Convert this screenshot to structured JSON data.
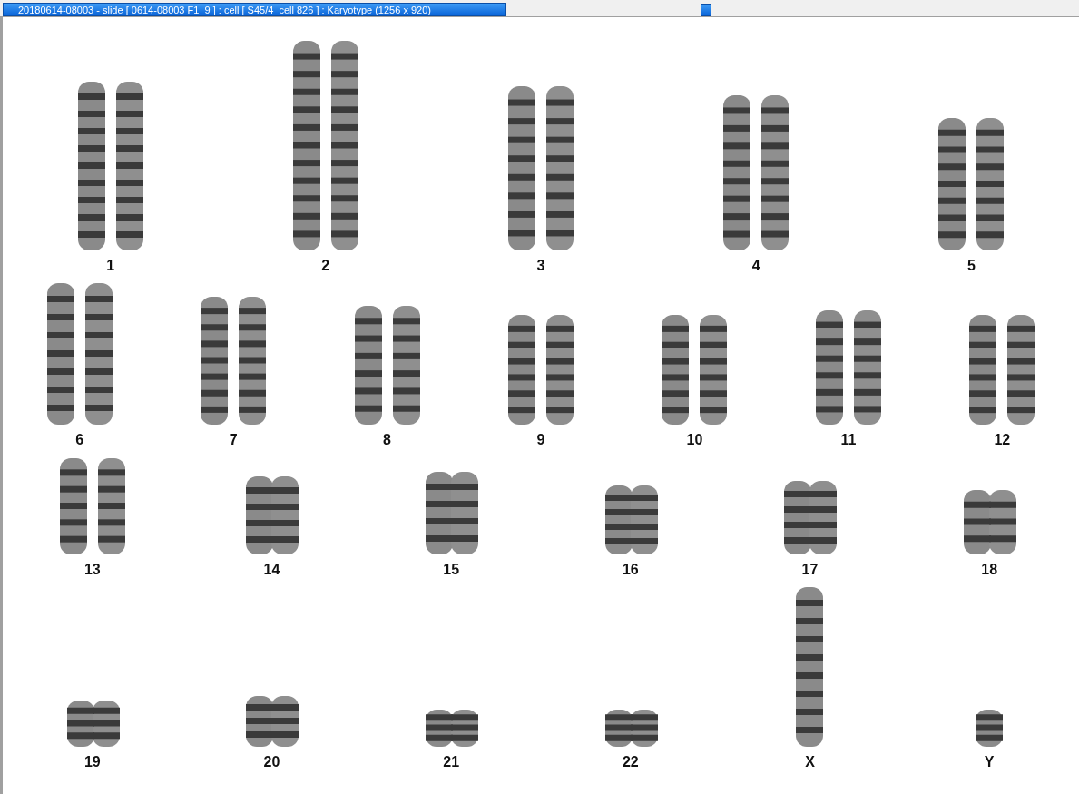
{
  "window": {
    "title": "20180614-08003 - slide [ 0614-08003 F1_9 ] : cell [ S45/4_cell 826 ] : Karyotype  (1256 x 920)"
  },
  "karyotype": {
    "rows": [
      {
        "items": [
          {
            "label": "1",
            "kind": "pair"
          },
          {
            "label": "2",
            "kind": "pair"
          },
          {
            "label": "3",
            "kind": "pair"
          },
          {
            "label": "4",
            "kind": "pair"
          },
          {
            "label": "5",
            "kind": "pair"
          }
        ]
      },
      {
        "items": [
          {
            "label": "6",
            "kind": "pair"
          },
          {
            "label": "7",
            "kind": "pair"
          },
          {
            "label": "8",
            "kind": "pair"
          },
          {
            "label": "9",
            "kind": "pair"
          },
          {
            "label": "10",
            "kind": "pair"
          },
          {
            "label": "11",
            "kind": "pair"
          },
          {
            "label": "12",
            "kind": "pair"
          }
        ]
      },
      {
        "items": [
          {
            "label": "13",
            "kind": "pair"
          },
          {
            "label": "14",
            "kind": "pair"
          },
          {
            "label": "15",
            "kind": "pair"
          },
          {
            "label": "16",
            "kind": "pair"
          },
          {
            "label": "17",
            "kind": "pair"
          },
          {
            "label": "18",
            "kind": "pair"
          }
        ]
      },
      {
        "items": [
          {
            "label": "19",
            "kind": "pair"
          },
          {
            "label": "20",
            "kind": "pair"
          },
          {
            "label": "21",
            "kind": "pair"
          },
          {
            "label": "22",
            "kind": "pair"
          },
          {
            "label": "X",
            "kind": "single"
          },
          {
            "label": "Y",
            "kind": "single"
          }
        ]
      }
    ]
  }
}
